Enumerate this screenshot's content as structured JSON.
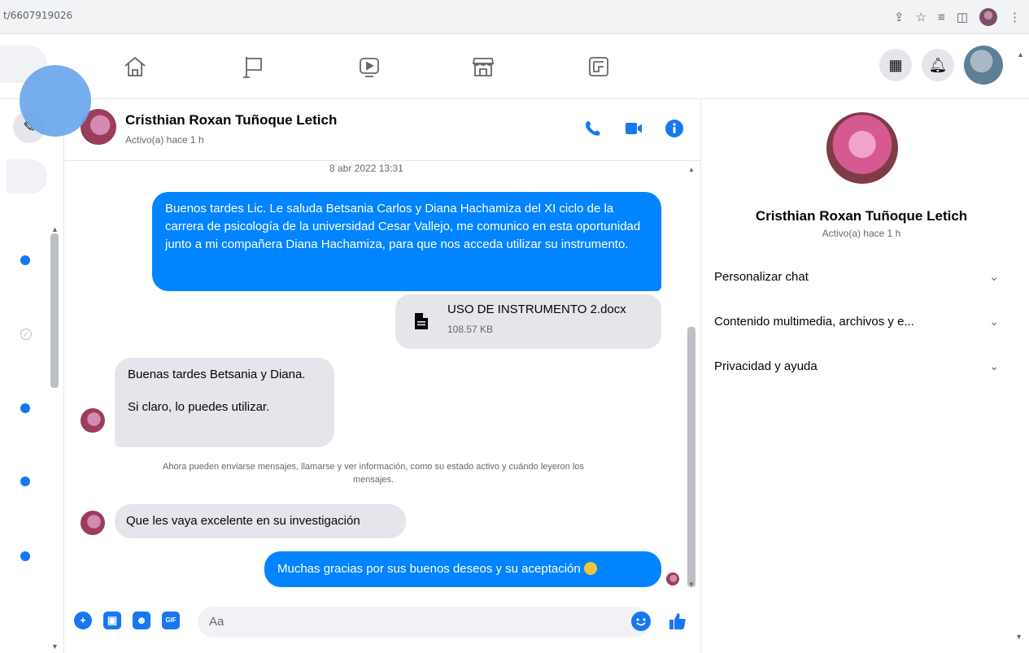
{
  "browser": {
    "url": "t/6607919026"
  },
  "chat": {
    "name": "Cristhian Roxan Tuñoque Letich",
    "status": "Activo(a) hace 1 h",
    "date_separator": "8 abr 2022 13:31",
    "messages": [
      {
        "text": "Buenos tardes Lic. Le saluda Betsania Carlos y Diana Hachamiza del XI ciclo de la carrera de psicología de la universidad Cesar Vallejo, me comunico en esta oportunidad junto a mi compañera Diana Hachamiza, para que nos acceda utilizar su instrumento."
      },
      {
        "text_line1": "Buenas tardes Betsania y Diana.",
        "text_line2": "Si claro, lo puedes utilizar."
      },
      {
        "text": "Que les vaya excelente en su investigación"
      },
      {
        "text": "Muchas gracias por sus buenos deseos y su aceptación"
      }
    ],
    "file": {
      "name": "USO DE INSTRUMENTO 2.docx",
      "size": "108.57 KB"
    },
    "system_note": "Ahora pueden enviarse mensajes, llamarse y ver información, como su estado activo y cuándo leyeron los mensajes.",
    "composer": {
      "placeholder": "Aa",
      "gif_label": "GIF"
    }
  },
  "info_panel": {
    "name": "Cristhian Roxan Tuñoque Letich",
    "status": "Activo(a) hace 1 h",
    "sections": [
      {
        "label": "Personalizar chat"
      },
      {
        "label": "Contenido multimedia, archivos y e..."
      },
      {
        "label": "Privacidad y ayuda"
      }
    ]
  },
  "colors": {
    "accent": "#1877f2",
    "outgoing_bubble": "#0084ff",
    "incoming_bubble": "#e4e6eb",
    "touch_marker": "#6aa6ea"
  },
  "icons": {
    "nav": [
      "home-icon",
      "flag-icon",
      "watch-icon",
      "marketplace-icon",
      "gaming-icon"
    ],
    "header": [
      "phone-icon",
      "video-icon",
      "info-icon"
    ],
    "composer": [
      "plus-icon",
      "photo-icon",
      "sticker-icon",
      "gif-icon",
      "emoji-icon",
      "like-icon"
    ]
  }
}
